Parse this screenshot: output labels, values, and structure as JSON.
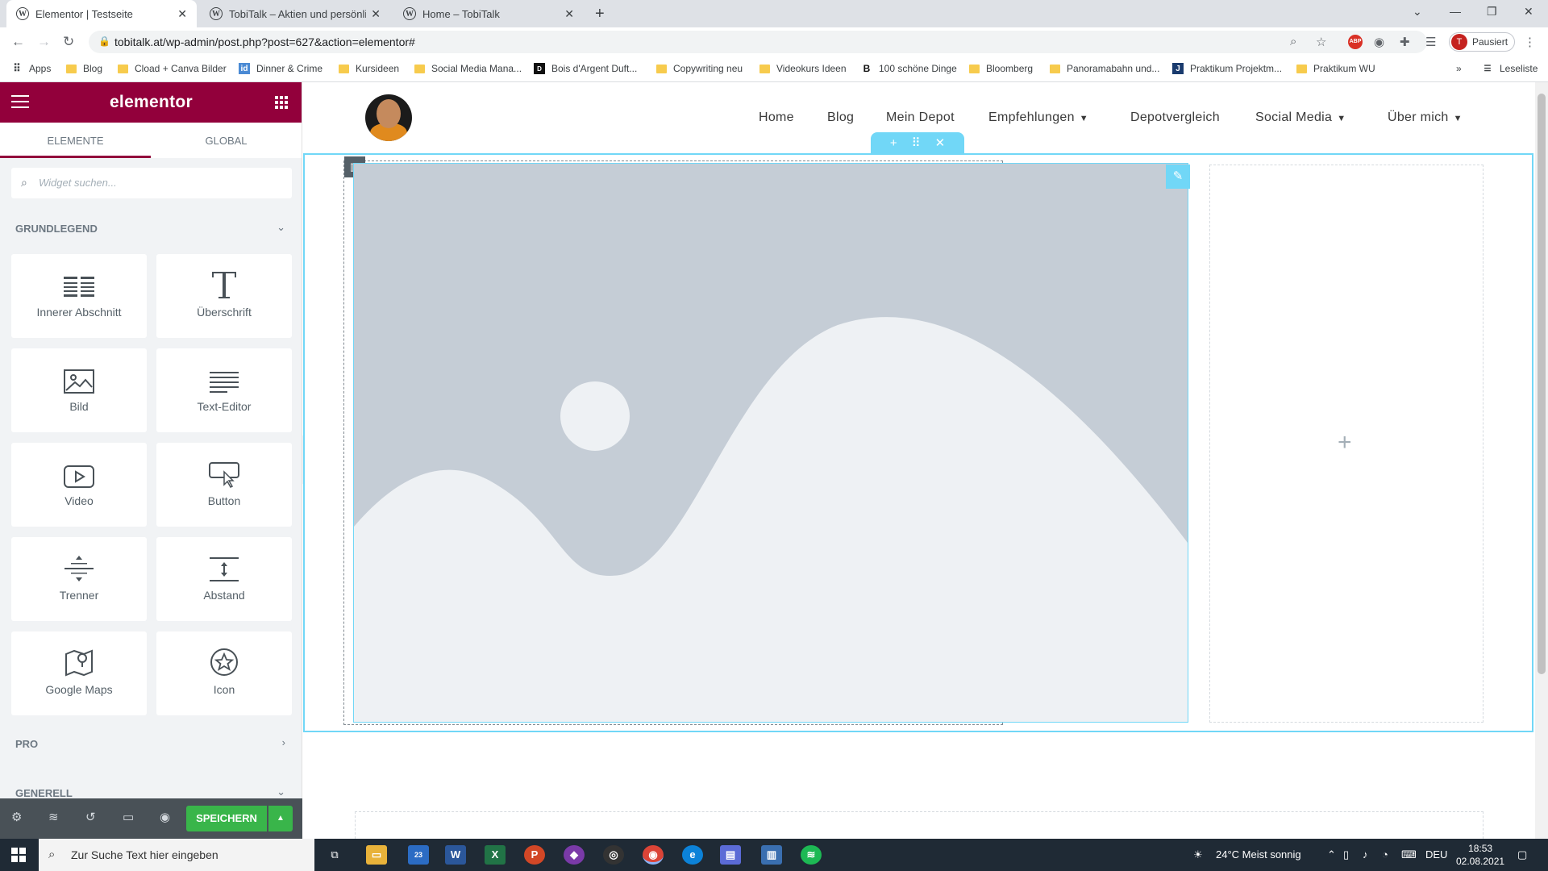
{
  "browser": {
    "tabs": [
      {
        "title": "Elementor | Testseite",
        "active": true
      },
      {
        "title": "TobiTalk – Aktien und persönliche",
        "active": false
      },
      {
        "title": "Home – TobiTalk",
        "active": false
      }
    ],
    "url": "tobitalk.at/wp-admin/post.php?post=627&action=elementor#",
    "profile_initial": "T",
    "profile_label": "Pausiert",
    "bookmarks": [
      {
        "label": "Apps"
      },
      {
        "label": "Blog"
      },
      {
        "label": "Cload + Canva Bilder"
      },
      {
        "label": "Dinner & Crime"
      },
      {
        "label": "Kursideen"
      },
      {
        "label": "Social Media Mana..."
      },
      {
        "label": "Bois d'Argent Duft..."
      },
      {
        "label": "Copywriting neu"
      },
      {
        "label": "Videokurs Ideen"
      },
      {
        "label": "100 schöne Dinge"
      },
      {
        "label": "Bloomberg"
      },
      {
        "label": "Panoramabahn und..."
      },
      {
        "label": "Praktikum Projektm..."
      },
      {
        "label": "Praktikum WU"
      }
    ],
    "reading_list": "Leseliste",
    "extension_badge": "ABP"
  },
  "panel": {
    "logo": "elementor",
    "tabs": [
      "ELEMENTE",
      "GLOBAL"
    ],
    "search_placeholder": "Widget suchen...",
    "category_basic": "GRUNDLEGEND",
    "category_pro": "PRO",
    "category_general": "GENERELL",
    "widgets": [
      {
        "label": "Innerer Abschnitt",
        "icon": "inner-section-icon"
      },
      {
        "label": "Überschrift",
        "icon": "heading-icon"
      },
      {
        "label": "Bild",
        "icon": "image-icon"
      },
      {
        "label": "Text-Editor",
        "icon": "text-editor-icon"
      },
      {
        "label": "Video",
        "icon": "video-icon"
      },
      {
        "label": "Button",
        "icon": "button-icon"
      },
      {
        "label": "Trenner",
        "icon": "divider-icon"
      },
      {
        "label": "Abstand",
        "icon": "spacer-icon"
      },
      {
        "label": "Google Maps",
        "icon": "map-icon"
      },
      {
        "label": "Icon",
        "icon": "star-icon"
      }
    ],
    "save_label": "SPEICHERN"
  },
  "site": {
    "nav": [
      {
        "label": "Home",
        "dropdown": false
      },
      {
        "label": "Blog",
        "dropdown": false
      },
      {
        "label": "Mein Depot",
        "dropdown": false
      },
      {
        "label": "Empfehlungen",
        "dropdown": true
      },
      {
        "label": "Depotvergleich",
        "dropdown": false
      },
      {
        "label": "Social Media",
        "dropdown": true
      },
      {
        "label": "Über mich",
        "dropdown": true
      }
    ]
  },
  "taskbar": {
    "search_placeholder": "Zur Suche Text hier eingeben",
    "mail_badge": "23",
    "weather": "24°C  Meist sonnig",
    "language": "DEU",
    "time": "18:53",
    "date": "02.08.2021"
  },
  "colors": {
    "elementor_brand": "#92003b",
    "editor_accent": "#71d7f7",
    "save_green": "#39b54a",
    "placeholder_image_bg": "#c5cdd6"
  }
}
